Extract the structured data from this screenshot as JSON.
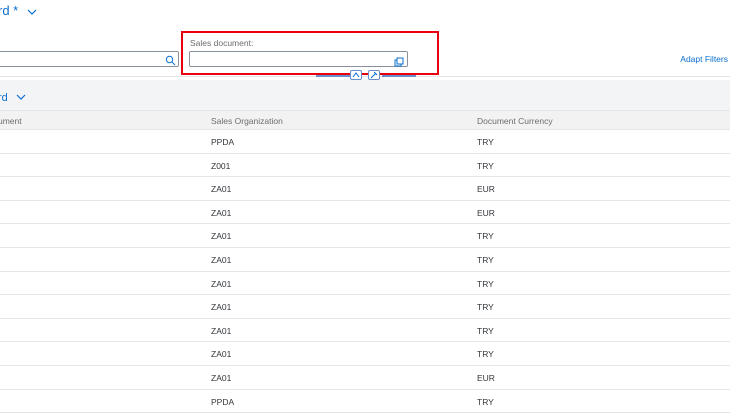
{
  "header": {
    "variant_title": "rd *",
    "adapt_filters": "Adapt Filters"
  },
  "filter": {
    "search_value": "",
    "sales_document_label": "Sales document:",
    "sales_document_value": ""
  },
  "table": {
    "variant_title": "rd",
    "columns": [
      "ument",
      "Sales Organization",
      "Document Currency"
    ],
    "rows": [
      {
        "doc": "",
        "org": "PPDA",
        "curr": "TRY"
      },
      {
        "doc": "",
        "org": "Z001",
        "curr": "TRY"
      },
      {
        "doc": "",
        "org": "ZA01",
        "curr": "EUR"
      },
      {
        "doc": "",
        "org": "ZA01",
        "curr": "EUR"
      },
      {
        "doc": "",
        "org": "ZA01",
        "curr": "TRY"
      },
      {
        "doc": "",
        "org": "ZA01",
        "curr": "TRY"
      },
      {
        "doc": "",
        "org": "ZA01",
        "curr": "TRY"
      },
      {
        "doc": "",
        "org": "ZA01",
        "curr": "TRY"
      },
      {
        "doc": "",
        "org": "ZA01",
        "curr": "TRY"
      },
      {
        "doc": "",
        "org": "ZA01",
        "curr": "TRY"
      },
      {
        "doc": "",
        "org": "ZA01",
        "curr": "EUR"
      },
      {
        "doc": "",
        "org": "PPDA",
        "curr": "TRY"
      }
    ]
  },
  "colors": {
    "accent": "#0a6ed1",
    "highlight": "#e8000f"
  },
  "icons": [
    "chevron-down-icon",
    "search-icon",
    "value-help-icon",
    "collapse-header-icon",
    "pin-header-icon"
  ]
}
